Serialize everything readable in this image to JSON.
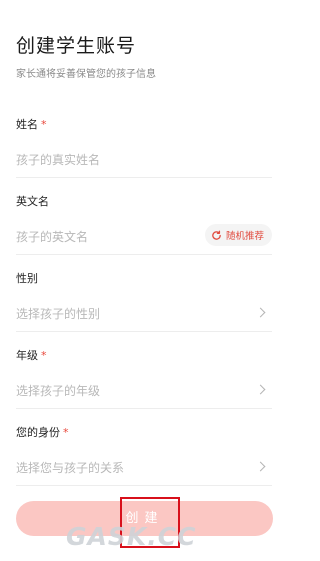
{
  "header": {
    "title": "创建学生账号",
    "subtitle": "家长通将妥善保管您的孩子信息"
  },
  "fields": [
    {
      "label": "姓名",
      "required": "*",
      "placeholder": "孩子的真实姓名"
    },
    {
      "label": "英文名",
      "required": "",
      "placeholder": "孩子的英文名",
      "action_label": "随机推荐"
    },
    {
      "label": "性别",
      "required": "",
      "placeholder": "选择孩子的性别"
    },
    {
      "label": "年级",
      "required": "*",
      "placeholder": "选择孩子的年级"
    },
    {
      "label": "您的身份",
      "required": "*",
      "placeholder": "选择您与孩子的关系"
    }
  ],
  "create_button": {
    "label": "创建"
  },
  "watermark": "GASK.CC",
  "colors": {
    "accent": "#e8483b",
    "button_bg": "#fbc7c3",
    "highlight": "#d8101b"
  },
  "icons": {
    "refresh": "refresh-icon",
    "chevron": "chevron-right-icon"
  }
}
